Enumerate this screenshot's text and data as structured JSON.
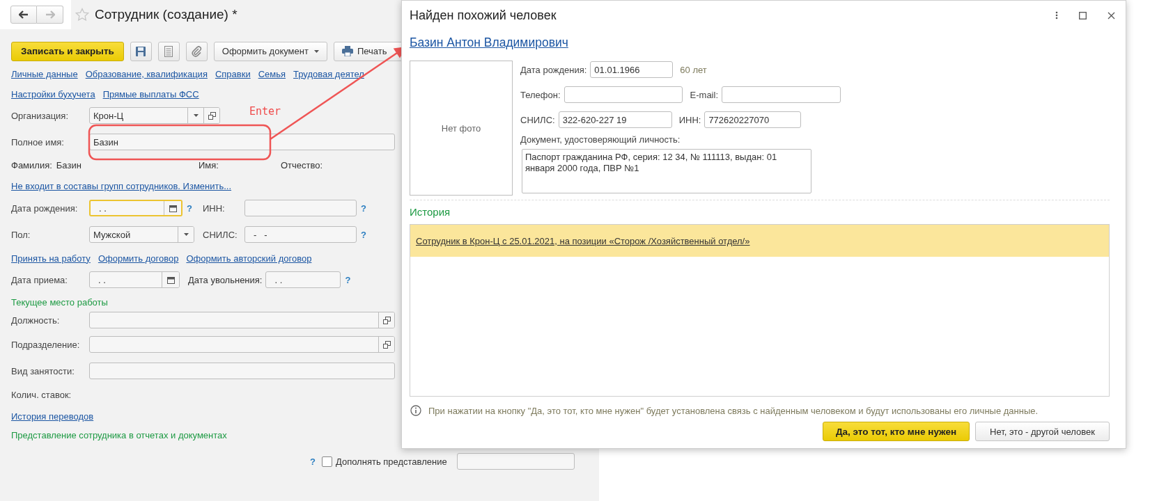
{
  "form": {
    "title": "Сотрудник (создание) *",
    "save_close_button": "Записать и закрыть",
    "document_button": "Оформить документ",
    "print_button": "Печать",
    "section_links": [
      [
        "Личные данные",
        "Образование, квалификация",
        "Справки",
        "Семья",
        "Трудовая деятел"
      ],
      [
        "Настройки бухучета",
        "Прямые выплаты ФСС"
      ]
    ],
    "organization": {
      "label": "Организация:",
      "value": "Крон-Ц"
    },
    "full_name": {
      "label": "Полное имя:",
      "value": "Базин"
    },
    "name_parts": [
      {
        "label": "Фамилия:",
        "value": "Базин"
      },
      {
        "label": "Имя:"
      },
      {
        "label": "Отчество:"
      }
    ],
    "groups_link": "Не входит в составы групп сотрудников. Изменить...",
    "birth_date": {
      "label": "Дата рождения:",
      "value": ". .",
      "focused": true,
      "help": "?"
    },
    "inn": {
      "label": "ИНН:",
      "help": "?"
    },
    "gender": {
      "label": "Пол:",
      "value": "Мужской"
    },
    "snils": {
      "label": "СНИЛС:",
      "value": "-   -",
      "help": "?"
    },
    "hire_links": [
      "Принять на работу",
      "Оформить договор",
      "Оформить авторский договор"
    ],
    "hire_date": {
      "label": "Дата приема:",
      "value": ". ."
    },
    "dismissal_date": {
      "label": "Дата увольнения:",
      "value": ". .",
      "help": "?"
    },
    "workplace_heading": "Текущее место работы",
    "workplace_fields": [
      {
        "label": "Должность:",
        "kind": "choice"
      },
      {
        "label": "Подразделение:",
        "kind": "choice"
      },
      {
        "label": "Вид занятости:",
        "kind": "text"
      },
      {
        "label": "Колич. ставок:",
        "kind": "empty"
      }
    ],
    "transfers_link": "История переводов",
    "presentation_heading": "Представление сотрудника в отчетах и документах",
    "supplement": {
      "help": "?",
      "label": "Дополнять представление",
      "checked": false
    }
  },
  "annotation": {
    "label": "Enter"
  },
  "dialog": {
    "title": "Найден похожий человек",
    "person_link": "Базин Антон Владимирович",
    "photo_placeholder": "Нет фото",
    "birth_date": {
      "label": "Дата рождения:",
      "value": "01.01.1966"
    },
    "age": "60 лет",
    "phone": {
      "label": "Телефон:"
    },
    "email": {
      "label": "E-mail:"
    },
    "snils": {
      "label": "СНИЛС:",
      "value": "322-620-227 19"
    },
    "inn": {
      "label": "ИНН:",
      "value": "772620227070"
    },
    "document": {
      "label": "Документ, удостоверяющий личность:",
      "value": "Паспорт гражданина РФ, серия: 12 34, № 111113, выдан: 01 января 2000 года, ПВР №1"
    },
    "history_heading": "История",
    "history": [
      {
        "text": "Сотрудник в Крон-Ц с 25.01.2021, на позиции «Сторож /Хозяйственный отдел/»",
        "selected": true
      }
    ],
    "info": "При нажатии на кнопку \"Да, это тот, кто мне нужен\" будет установлена связь с найденным человеком и будут использованы его личные данные.",
    "confirm_button": "Да, это тот, кто мне нужен",
    "reject_button": "Нет, это - другой человек"
  }
}
